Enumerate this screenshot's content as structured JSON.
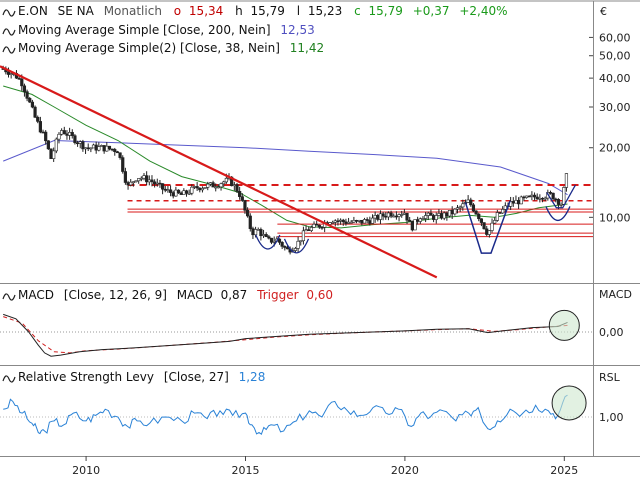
{
  "chart_data": [
    {
      "type": "line",
      "panel": "price",
      "legend": {
        "symbol": "E.ON",
        "exchange": "SE NA",
        "interval": "Monatlich",
        "o_label": "o",
        "o_value": "15,34",
        "h_label": "h",
        "h_value": "15,79",
        "l_label": "l",
        "l_value": "15,23",
        "c_label": "c",
        "c_value": "15,79",
        "change": "+0,37",
        "change_pct": "+2,40%"
      },
      "indicators": [
        {
          "label": "Moving Average Simple [Close, 200, Nein]",
          "value": "12,53",
          "color": "#5050c0"
        },
        {
          "label": "Moving Average Simple(2) [Close, 38, Nein]",
          "value": "11,42",
          "color": "#208020"
        }
      ],
      "currency_label": "€",
      "yscale": "log",
      "ylim": [
        5.2,
        75
      ],
      "yticks": [
        10,
        20,
        30,
        40,
        50,
        60
      ],
      "ytick_labels": [
        "10,00",
        "20,00",
        "30,00",
        "40,00",
        "50,00",
        "60,00"
      ],
      "xlim": [
        2007.3,
        2025.9
      ],
      "xticks": [
        2010,
        2015,
        2020,
        2025
      ],
      "xtick_labels": [
        "2010",
        "2015",
        "2020",
        "2025"
      ],
      "price_series": {
        "x": [
          2007.4,
          2007.8,
          2008.0,
          2008.4,
          2008.7,
          2008.9,
          2009.2,
          2009.6,
          2010.0,
          2010.5,
          2011.0,
          2011.3,
          2011.6,
          2012.0,
          2012.5,
          2013.0,
          2013.5,
          2014.0,
          2014.5,
          2014.8,
          2015.2,
          2015.4,
          2015.7,
          2016.0,
          2016.3,
          2016.6,
          2016.9,
          2017.3,
          2017.7,
          2018.0,
          2018.5,
          2019.0,
          2019.5,
          2020.0,
          2020.2,
          2020.5,
          2021.0,
          2021.5,
          2022.0,
          2022.3,
          2022.6,
          2022.9,
          2023.3,
          2023.8,
          2024.2,
          2024.6,
          2024.9,
          2025.1
        ],
        "y": [
          44,
          41,
          38,
          27,
          22,
          18,
          24,
          22,
          20,
          20,
          19.5,
          13.5,
          15,
          14.5,
          13,
          12.5,
          13.5,
          13.8,
          14.5,
          12.8,
          8.6,
          8.8,
          7.9,
          8.0,
          7.2,
          7.6,
          8.8,
          9.2,
          9.8,
          9.6,
          9.5,
          9.8,
          10.4,
          10.5,
          9.0,
          10.2,
          10.0,
          10.5,
          11.7,
          10.2,
          8.5,
          10.2,
          11.5,
          12.0,
          12.4,
          12.5,
          11.5,
          15.79
        ]
      },
      "ma200_series": {
        "x": [
          2007.4,
          2009.0,
          2011.0,
          2013.0,
          2015.0,
          2017.0,
          2019.0,
          2021.0,
          2023.0,
          2024.5,
          2025.1
        ],
        "y": [
          17.5,
          21.5,
          21.0,
          20.5,
          20.0,
          19.3,
          18.7,
          18.0,
          16.5,
          14.0,
          12.53
        ]
      },
      "ma38_series": {
        "x": [
          2007.4,
          2008.3,
          2009.0,
          2010.0,
          2011.0,
          2012.0,
          2013.0,
          2014.0,
          2014.8,
          2015.5,
          2016.3,
          2017.0,
          2018.0,
          2019.0,
          2020.0,
          2021.0,
          2022.0,
          2022.8,
          2023.5,
          2024.2,
          2025.1
        ],
        "y": [
          37,
          34,
          30,
          25,
          21.5,
          17.5,
          15.0,
          13.8,
          12.8,
          11.3,
          9.7,
          9.1,
          9.0,
          9.3,
          9.5,
          9.9,
          10.2,
          10.0,
          10.4,
          11.0,
          11.42
        ]
      },
      "trendline": {
        "x": [
          2007.3,
          2021.0
        ],
        "y": [
          45,
          5.5
        ],
        "color": "#d81a1a"
      },
      "resistance_dashed": {
        "x": [
          2011.3,
          2025.9
        ],
        "y": 13.8,
        "color": "#d81a1a"
      },
      "support_dashed": {
        "x": [
          2011.3,
          2025.9
        ],
        "y": 11.8,
        "color": "#d81a1a"
      },
      "support_bands": [
        {
          "x": [
            2011.3,
            2025.9
          ],
          "y": 10.85,
          "color": "#d81a1a"
        },
        {
          "x": [
            2011.3,
            2025.9
          ],
          "y": 10.55,
          "color": "#d81a1a"
        },
        {
          "x": [
            2016.0,
            2025.9
          ],
          "y": 9.35,
          "color": "#d81a1a"
        },
        {
          "x": [
            2016.0,
            2025.9
          ],
          "y": 8.55,
          "color": "#d81a1a"
        },
        {
          "x": [
            2016.0,
            2025.9
          ],
          "y": 8.25,
          "color": "#d81a1a"
        }
      ],
      "pattern_color": "#1a2a8a"
    },
    {
      "type": "line",
      "panel": "macd",
      "label": "MACD",
      "params": "[Close, 12, 26, 9]",
      "value_label": "MACD",
      "value": "0,87",
      "trigger_label": "Trigger",
      "trigger_value": "0,60",
      "axis_label": "MACD",
      "ylim": [
        -3.0,
        3.0
      ],
      "yticks": [
        0
      ],
      "ytick_labels": [
        "0,00"
      ],
      "macd_series": {
        "x": [
          2007.4,
          2007.8,
          2008.2,
          2008.5,
          2008.7,
          2008.9,
          2009.2,
          2009.8,
          2010.5,
          2011.5,
          2012.5,
          2013.5,
          2014.5,
          2015.0,
          2016.0,
          2017.0,
          2018.0,
          2019.0,
          2020.0,
          2021.0,
          2022.0,
          2022.6,
          2023.2,
          2024.0,
          2024.8,
          2025.1
        ],
        "y": [
          1.6,
          1.2,
          0.0,
          -1.2,
          -1.9,
          -2.2,
          -2.1,
          -1.8,
          -1.6,
          -1.45,
          -1.25,
          -1.05,
          -0.85,
          -0.6,
          -0.4,
          -0.2,
          -0.1,
          0.0,
          0.1,
          0.25,
          0.3,
          -0.05,
          0.15,
          0.4,
          0.5,
          0.87
        ]
      },
      "trigger_series": {
        "x": [
          2007.4,
          2008.0,
          2008.5,
          2009.0,
          2009.5,
          2010.0,
          2011.0,
          2012.0,
          2013.0,
          2014.0,
          2015.0,
          2016.0,
          2017.0,
          2018.0,
          2019.0,
          2020.0,
          2021.0,
          2022.0,
          2022.8,
          2023.5,
          2024.3,
          2025.1
        ],
        "y": [
          1.4,
          0.8,
          -0.8,
          -1.8,
          -1.9,
          -1.7,
          -1.55,
          -1.35,
          -1.15,
          -0.95,
          -0.7,
          -0.45,
          -0.25,
          -0.12,
          0.0,
          0.1,
          0.22,
          0.3,
          0.05,
          0.2,
          0.42,
          0.6
        ]
      }
    },
    {
      "type": "line",
      "panel": "rsl",
      "label": "Relative Strength Levy",
      "params": "[Close, 27]",
      "value": "1,28",
      "axis_label": "RSL",
      "ylim": [
        0.5,
        1.5
      ],
      "yticks": [
        1.0
      ],
      "ytick_labels": [
        "1,00"
      ],
      "series": {
        "x": [
          2007.4,
          2007.7,
          2008.0,
          2008.3,
          2008.5,
          2008.7,
          2009.0,
          2009.3,
          2009.6,
          2010.0,
          2010.3,
          2010.6,
          2011.0,
          2011.3,
          2011.6,
          2012.0,
          2012.5,
          2013.0,
          2013.4,
          2013.8,
          2014.2,
          2014.6,
          2015.0,
          2015.2,
          2015.5,
          2015.8,
          2016.2,
          2016.6,
          2017.0,
          2017.4,
          2017.8,
          2018.2,
          2018.6,
          2019.0,
          2019.4,
          2019.8,
          2020.2,
          2020.5,
          2020.8,
          2021.2,
          2021.6,
          2022.0,
          2022.3,
          2022.6,
          2022.9,
          2023.3,
          2023.7,
          2024.1,
          2024.5,
          2024.8,
          2025.1
        ],
        "y": [
          1.1,
          1.2,
          1.05,
          0.92,
          0.8,
          0.82,
          0.95,
          0.9,
          1.05,
          0.95,
          1.02,
          1.1,
          1.0,
          0.88,
          0.95,
          0.92,
          1.0,
          0.95,
          1.05,
          0.98,
          1.08,
          1.02,
          1.05,
          0.9,
          0.78,
          0.9,
          0.82,
          0.95,
          1.08,
          1.0,
          1.2,
          1.08,
          1.02,
          1.12,
          1.05,
          1.1,
          0.88,
          1.05,
          1.0,
          1.08,
          0.95,
          1.05,
          1.12,
          0.85,
          0.95,
          1.1,
          1.05,
          1.15,
          1.08,
          1.02,
          1.28
        ]
      }
    }
  ]
}
